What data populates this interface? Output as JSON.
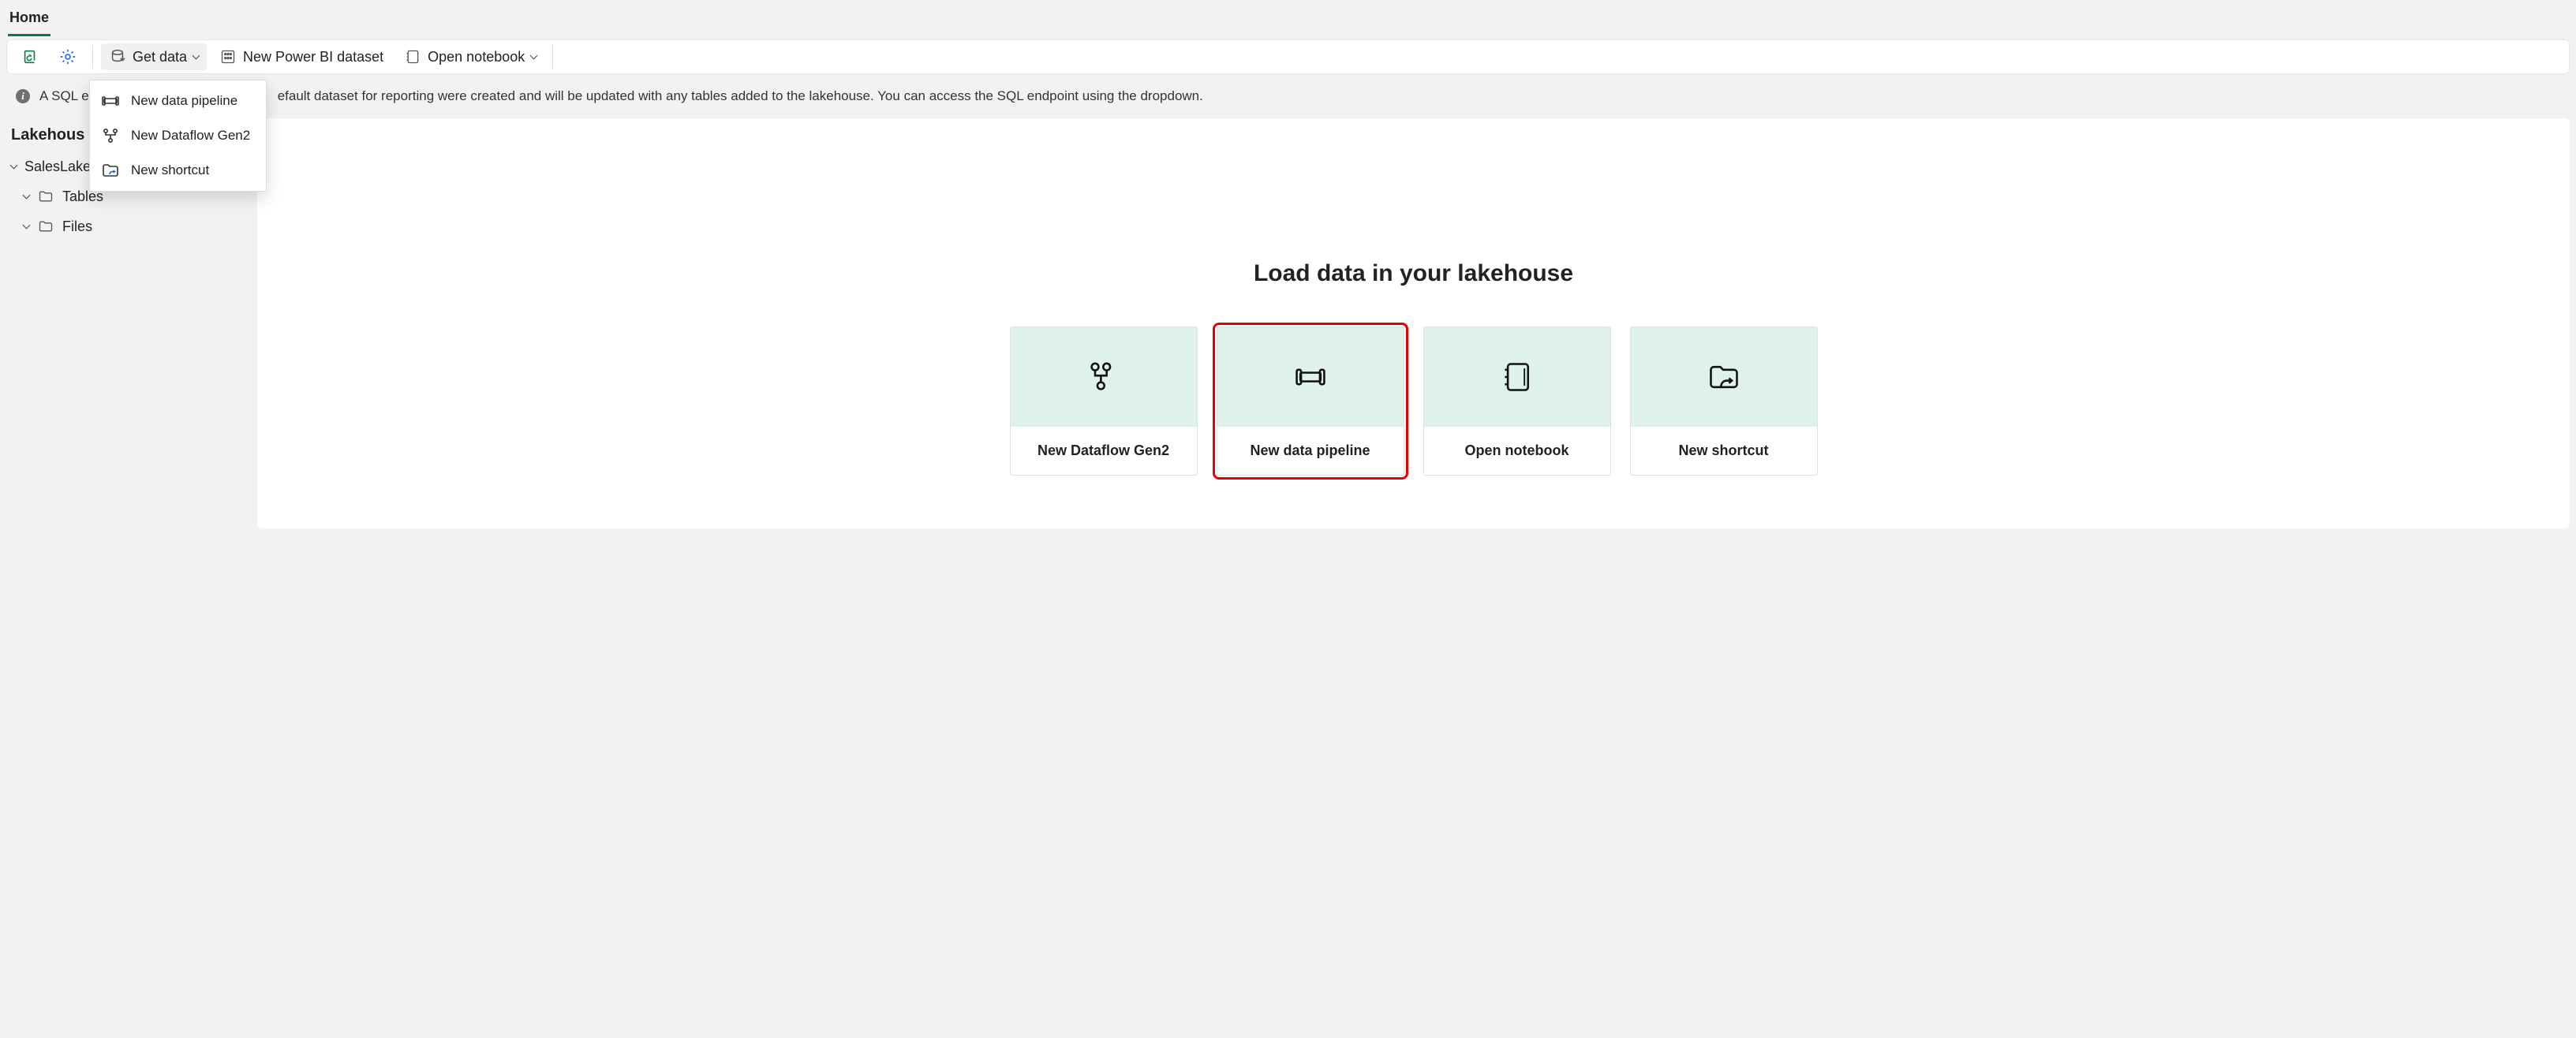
{
  "header": {
    "tabs": [
      {
        "label": "Home",
        "active": true
      }
    ]
  },
  "toolbar": {
    "get_data_label": "Get data",
    "new_dataset_label": "New Power BI dataset",
    "open_notebook_label": "Open notebook"
  },
  "dropdown": {
    "items": [
      {
        "icon": "pipeline",
        "label": "New data pipeline"
      },
      {
        "icon": "dataflow",
        "label": "New Dataflow Gen2"
      },
      {
        "icon": "shortcut",
        "label": "New shortcut"
      }
    ]
  },
  "notification": {
    "text_visible_left": "A SQL e",
    "text_visible_right": "efault dataset for reporting were created and will be updated with any tables added to the lakehouse. You can access the SQL endpoint using the dropdown."
  },
  "explorer": {
    "heading_visible": "Lakehous",
    "root": {
      "label": "SalesLakehouse"
    },
    "children": [
      {
        "icon": "folder",
        "label": "Tables"
      },
      {
        "icon": "folder",
        "label": "Files"
      }
    ]
  },
  "main": {
    "hero": "Load data in your lakehouse",
    "cards": [
      {
        "icon": "dataflow",
        "label": "New Dataflow Gen2",
        "highlight": false
      },
      {
        "icon": "pipeline",
        "label": "New data pipeline",
        "highlight": true
      },
      {
        "icon": "notebook",
        "label": "Open notebook",
        "highlight": false
      },
      {
        "icon": "shortcut",
        "label": "New shortcut",
        "highlight": false
      }
    ]
  }
}
